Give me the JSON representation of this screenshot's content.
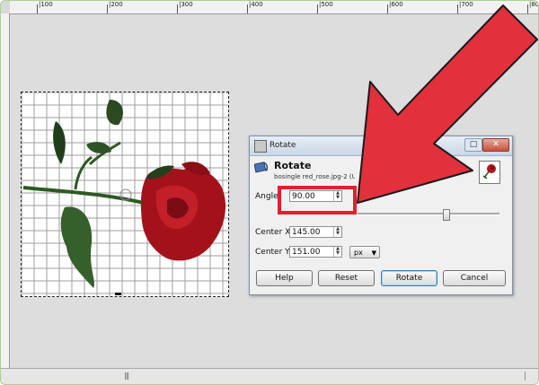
{
  "ruler": {
    "labels": [
      "|100",
      "|200",
      "|300",
      "|400",
      "|500",
      "|600",
      "|700",
      "|800"
    ]
  },
  "dialog": {
    "window_title": "Rotate",
    "header_title": "Rotate",
    "header_subtitle": "bosingle red_rose.jpg-2 (Untitled)",
    "close_label": "✕",
    "maximize_label": "□",
    "angle": {
      "label": "Angle:",
      "value": "90.00"
    },
    "center_x": {
      "label": "Center X:",
      "value": "145.00"
    },
    "center_y": {
      "label": "Center Y:",
      "value": "151.00"
    },
    "unit": "px",
    "slider_level_percent": 62,
    "buttons": {
      "help": "Help",
      "reset": "Reset",
      "rotate": "Rotate",
      "cancel": "Cancel"
    }
  },
  "icons": {
    "header": "rotate-tool-icon",
    "thumbnail": "rose-thumbnail-icon",
    "spin": "spin-arrows-icon",
    "dropdown": "chevron-down-icon"
  },
  "colors": {
    "highlight": "#e2202e",
    "arrow": "#e3303d",
    "dialog_border": "#7d8fa8"
  }
}
